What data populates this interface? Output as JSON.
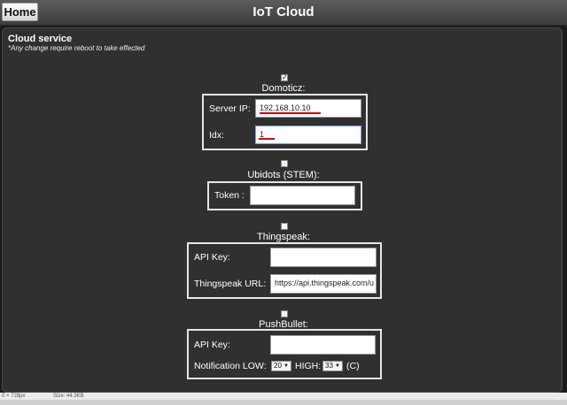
{
  "header": {
    "home_label": "Home",
    "title": "IoT Cloud"
  },
  "section": {
    "title": "Cloud service",
    "note": "*Any change require reboot to take effected"
  },
  "domoticz": {
    "enabled": true,
    "label": "Domoticz:",
    "server_ip_label": "Server IP:",
    "server_ip_value": "192.168.10.10",
    "idx_label": "Idx:",
    "idx_value": "1"
  },
  "ubidots": {
    "enabled": false,
    "label": "Ubidots (STEM):",
    "token_label": "Token :",
    "token_value": ""
  },
  "thingspeak": {
    "enabled": false,
    "label": "Thingspeak:",
    "api_key_label": "API Key:",
    "api_key_value": "",
    "url_label": "Thingspeak URL:",
    "url_value": "https://api.thingspeak.com/u"
  },
  "pushbullet": {
    "enabled": false,
    "label": "PushBullet:",
    "api_key_label": "API Key:",
    "api_key_value": "",
    "notif_low_label": "Notification LOW:",
    "low_value": "20",
    "high_label": "HIGH:",
    "high_value": "33",
    "unit": "(C)"
  },
  "statusbar": {
    "dimensions": "0 × 728px",
    "size": "Size: 44.3KB"
  },
  "colors": {
    "background": "#1a1a1a",
    "panel": "#303030",
    "underline": "#d40000"
  }
}
